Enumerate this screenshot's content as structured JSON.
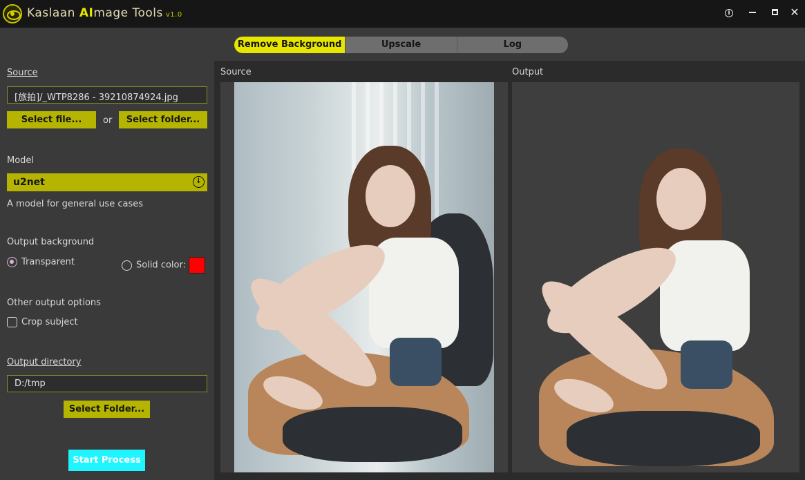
{
  "app": {
    "title_prefix": "Kaslaan ",
    "title_ai": "AI",
    "title_suffix": "mage Tools",
    "version": "v1.0"
  },
  "tabs": [
    {
      "label": "Remove Background",
      "active": true
    },
    {
      "label": "Upscale",
      "active": false
    },
    {
      "label": "Log",
      "active": false
    }
  ],
  "source": {
    "label": "Source",
    "file_value": "[旅拍]/_WTP8286 - 39210874924.jpg",
    "select_file": "Select file...",
    "or": "or",
    "select_folder": "Select folder..."
  },
  "model": {
    "label": "Model",
    "selected": "u2net",
    "description": "A model for general use cases"
  },
  "output_background": {
    "label": "Output background",
    "transparent": "Transparent",
    "solid": "Solid color:",
    "solid_color": "#ff0000",
    "selected": "transparent"
  },
  "other_options": {
    "label": "Other output options",
    "crop_subject": "Crop subject",
    "crop_checked": false
  },
  "output_dir": {
    "label": "Output directory",
    "value": "D:/tmp",
    "select_folder": "Select Folder..."
  },
  "start": "Start Process",
  "preview": {
    "source_title": "Source",
    "output_title": "Output"
  },
  "colors": {
    "accent": "#e6e600",
    "button": "#b5b400",
    "start": "#1ff5ff"
  }
}
